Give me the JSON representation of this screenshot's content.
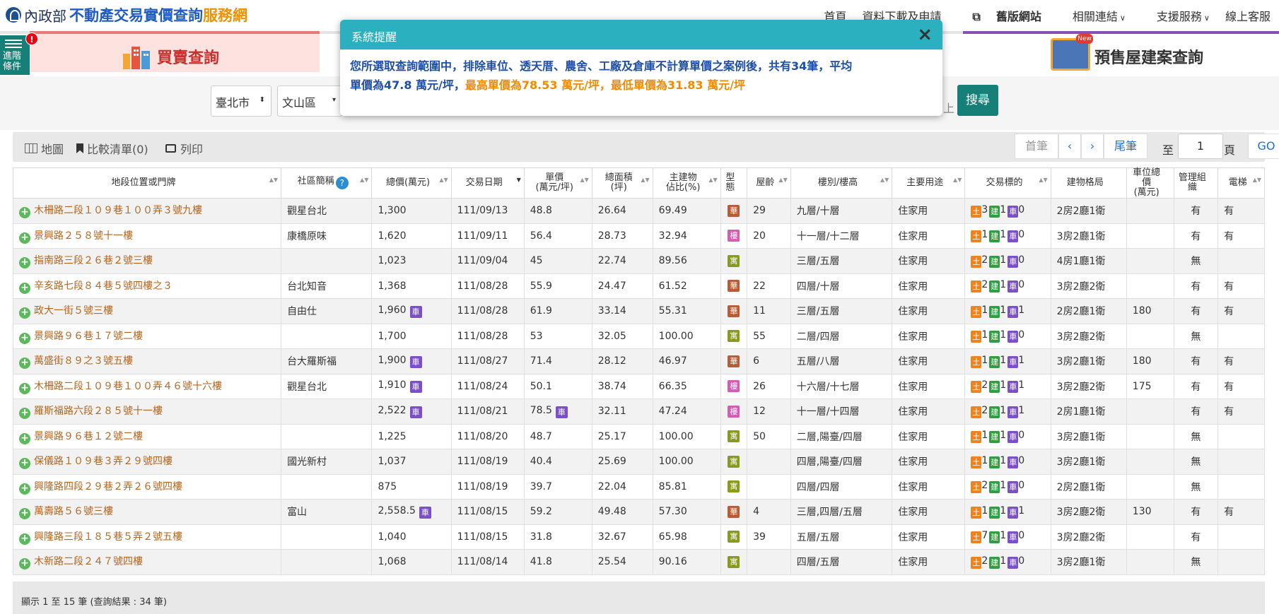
{
  "header": {
    "ministry": "內政部",
    "title": "不動產交易實價查詢",
    "title_suffix": "服務網",
    "nav": [
      {
        "label": "首頁"
      },
      {
        "label": "資料下載及申請"
      },
      {
        "label": "舊版網站"
      },
      {
        "label": "相關連結"
      },
      {
        "label": "支援服務"
      },
      {
        "label": "線上客服"
      }
    ]
  },
  "banner": {
    "buy_sell": "買賣查詢",
    "presale": "預售屋建案查詢",
    "presale_badge": "New",
    "advanced_line1": "進階",
    "advanced_line2": "條件",
    "advanced_badge": "!"
  },
  "search": {
    "city": "臺北市",
    "district": "文山區",
    "hidden_text": "上",
    "button": "搜尋"
  },
  "toolbar": {
    "map": "地圖",
    "compare": "比較清單(0)",
    "print": "列印",
    "first": "首筆",
    "prev": "‹",
    "next": "›",
    "last": "尾筆",
    "to": "至",
    "page": "1",
    "page_unit": "頁",
    "go": "GO"
  },
  "columns": [
    "地段位置或門牌",
    "社區簡稱",
    "總價(萬元)",
    "交易日期",
    "單價\n(萬元/坪)",
    "總面積\n(坪)",
    "主建物\n佔比(%)",
    "型態",
    "屋齡",
    "樓別/樓高",
    "主要用途",
    "交易標的",
    "建物格局",
    "車位總價\n(萬元)",
    "管理組織",
    "電梯"
  ],
  "rows": [
    {
      "addr": "木柵路二段１０９巷１００弄３號九樓",
      "community": "觀星台北",
      "total": "1,300",
      "total_car": false,
      "date": "111/09/13",
      "unit": "48.8",
      "unit_car": false,
      "area": "26.64",
      "ratio": "69.49",
      "type": "華",
      "age": "29",
      "floor": "九層/十層",
      "use": "住家用",
      "land": "3",
      "bld": "1",
      "car": "0",
      "layout": "2房2廳1衛",
      "car_price": "",
      "mgmt": "有",
      "elev": "有"
    },
    {
      "addr": "景興路２５８號十一樓",
      "community": "康橋原味",
      "total": "1,620",
      "total_car": false,
      "date": "111/09/11",
      "unit": "56.4",
      "unit_car": false,
      "area": "28.73",
      "ratio": "32.94",
      "type": "樓",
      "age": "20",
      "floor": "十一層/十二層",
      "use": "住家用",
      "land": "1",
      "bld": "1",
      "car": "0",
      "layout": "3房2廳1衛",
      "car_price": "",
      "mgmt": "有",
      "elev": "有"
    },
    {
      "addr": "指南路三段２６巷２號三樓",
      "community": "",
      "total": "1,023",
      "total_car": false,
      "date": "111/09/04",
      "unit": "45",
      "unit_car": false,
      "area": "22.74",
      "ratio": "89.56",
      "type": "寓",
      "age": "",
      "floor": "三層/五層",
      "use": "住家用",
      "land": "2",
      "bld": "1",
      "car": "0",
      "layout": "4房1廳1衛",
      "car_price": "",
      "mgmt": "無",
      "elev": ""
    },
    {
      "addr": "辛亥路七段８４巷５號四樓之３",
      "community": "台北知音",
      "total": "1,368",
      "total_car": false,
      "date": "111/08/28",
      "unit": "55.9",
      "unit_car": false,
      "area": "24.47",
      "ratio": "61.52",
      "type": "華",
      "age": "22",
      "floor": "四層/十層",
      "use": "住家用",
      "land": "2",
      "bld": "1",
      "car": "0",
      "layout": "3房2廳2衛",
      "car_price": "",
      "mgmt": "有",
      "elev": "有"
    },
    {
      "addr": "政大一街５號三樓",
      "community": "自由仕",
      "total": "1,960",
      "total_car": true,
      "date": "111/08/28",
      "unit": "61.9",
      "unit_car": false,
      "area": "33.14",
      "ratio": "55.31",
      "type": "華",
      "age": "11",
      "floor": "三層/五層",
      "use": "住家用",
      "land": "1",
      "bld": "1",
      "car": "1",
      "layout": "2房2廳1衛",
      "car_price": "180",
      "mgmt": "有",
      "elev": "有"
    },
    {
      "addr": "景興路９６巷１７號二樓",
      "community": "",
      "total": "1,700",
      "total_car": false,
      "date": "111/08/28",
      "unit": "53",
      "unit_car": false,
      "area": "32.05",
      "ratio": "100.00",
      "type": "寓",
      "age": "55",
      "floor": "二層/四層",
      "use": "住家用",
      "land": "1",
      "bld": "1",
      "car": "0",
      "layout": "3房2廳2衛",
      "car_price": "",
      "mgmt": "無",
      "elev": ""
    },
    {
      "addr": "萬盛街８９之３號五樓",
      "community": "台大羅斯福",
      "total": "1,900",
      "total_car": true,
      "date": "111/08/27",
      "unit": "71.4",
      "unit_car": false,
      "area": "28.12",
      "ratio": "46.97",
      "type": "華",
      "age": "6",
      "floor": "五層/八層",
      "use": "住家用",
      "land": "1",
      "bld": "1",
      "car": "1",
      "layout": "3房2廳1衛",
      "car_price": "180",
      "mgmt": "有",
      "elev": "有"
    },
    {
      "addr": "木柵路二段１０９巷１００弄４６號十六樓",
      "community": "觀星台北",
      "total": "1,910",
      "total_car": true,
      "date": "111/08/24",
      "unit": "50.1",
      "unit_car": false,
      "area": "38.74",
      "ratio": "66.35",
      "type": "樓",
      "age": "26",
      "floor": "十六層/十七層",
      "use": "住家用",
      "land": "2",
      "bld": "1",
      "car": "1",
      "layout": "3房2廳2衛",
      "car_price": "175",
      "mgmt": "有",
      "elev": "有"
    },
    {
      "addr": "羅斯福路六段２８５號十一樓",
      "community": "",
      "total": "2,522",
      "total_car": true,
      "date": "111/08/21",
      "unit": "78.5",
      "unit_car": true,
      "area": "32.11",
      "ratio": "47.24",
      "type": "樓",
      "age": "12",
      "floor": "十一層/十四層",
      "use": "住家用",
      "land": "2",
      "bld": "1",
      "car": "1",
      "layout": "2房1廳1衛",
      "car_price": "",
      "mgmt": "有",
      "elev": "有"
    },
    {
      "addr": "景興路９６巷１２號二樓",
      "community": "",
      "total": "1,225",
      "total_car": false,
      "date": "111/08/20",
      "unit": "48.7",
      "unit_car": false,
      "area": "25.17",
      "ratio": "100.00",
      "type": "寓",
      "age": "50",
      "floor": "二層,陽臺/四層",
      "use": "住家用",
      "land": "1",
      "bld": "1",
      "car": "0",
      "layout": "3房2廳1衛",
      "car_price": "",
      "mgmt": "無",
      "elev": ""
    },
    {
      "addr": "保儀路１０９巷３弄２９號四樓",
      "community": "國光新村",
      "total": "1,037",
      "total_car": false,
      "date": "111/08/19",
      "unit": "40.4",
      "unit_car": false,
      "area": "25.69",
      "ratio": "100.00",
      "type": "寓",
      "age": "",
      "floor": "四層,陽臺/四層",
      "use": "住家用",
      "land": "1",
      "bld": "1",
      "car": "0",
      "layout": "3房2廳1衛",
      "car_price": "",
      "mgmt": "無",
      "elev": ""
    },
    {
      "addr": "興隆路四段２９巷２弄２６號四樓",
      "community": "",
      "total": "875",
      "total_car": false,
      "date": "111/08/19",
      "unit": "39.7",
      "unit_car": false,
      "area": "22.04",
      "ratio": "85.81",
      "type": "寓",
      "age": "",
      "floor": "四層/四層",
      "use": "住家用",
      "land": "2",
      "bld": "1",
      "car": "0",
      "layout": "2房2廳1衛",
      "car_price": "",
      "mgmt": "無",
      "elev": ""
    },
    {
      "addr": "萬壽路５６號三樓",
      "community": "富山",
      "total": "2,558.5",
      "total_car": true,
      "date": "111/08/15",
      "unit": "59.2",
      "unit_car": false,
      "area": "49.48",
      "ratio": "57.30",
      "type": "華",
      "age": "4",
      "floor": "三層,四層/五層",
      "use": "住家用",
      "land": "1",
      "bld": "1",
      "car": "1",
      "layout": "3房2廳2衛",
      "car_price": "130",
      "mgmt": "有",
      "elev": "有"
    },
    {
      "addr": "興隆路三段１８５巷５弄２號五樓",
      "community": "",
      "total": "1,040",
      "total_car": false,
      "date": "111/08/15",
      "unit": "31.8",
      "unit_car": false,
      "area": "32.67",
      "ratio": "65.98",
      "type": "寓",
      "age": "39",
      "floor": "五層/五層",
      "use": "住家用",
      "land": "7",
      "bld": "1",
      "car": "0",
      "layout": "3房2廳2衛",
      "car_price": "",
      "mgmt": "有",
      "elev": ""
    },
    {
      "addr": "木新路二段２４７號四樓",
      "community": "",
      "total": "1,068",
      "total_car": false,
      "date": "111/08/14",
      "unit": "41.8",
      "unit_car": false,
      "area": "25.54",
      "ratio": "90.16",
      "type": "寓",
      "age": "",
      "floor": "四層/五層",
      "use": "住家用",
      "land": "2",
      "bld": "1",
      "car": "0",
      "layout": "3房2廳1衛",
      "car_price": "",
      "mgmt": "無",
      "elev": ""
    }
  ],
  "glyphs": {
    "plus": "+",
    "car": "車",
    "land": "土",
    "bld": "建",
    "info": "?"
  },
  "footer": {
    "text": "顯示 1 至 15 筆 (查詢結果 : 34 筆)"
  },
  "modal": {
    "title": "系統提醒",
    "close": "×",
    "line1": "您所選取查詢範圍中，排除車位、透天厝、農舍、工廠及倉庫不計算單價之案例後，共有34筆，平均",
    "line2a": "單價為47.8 萬元/坪，",
    "line2b": "最高單價為78.53 萬元/坪，最低單價為31.83 萬元/坪"
  }
}
